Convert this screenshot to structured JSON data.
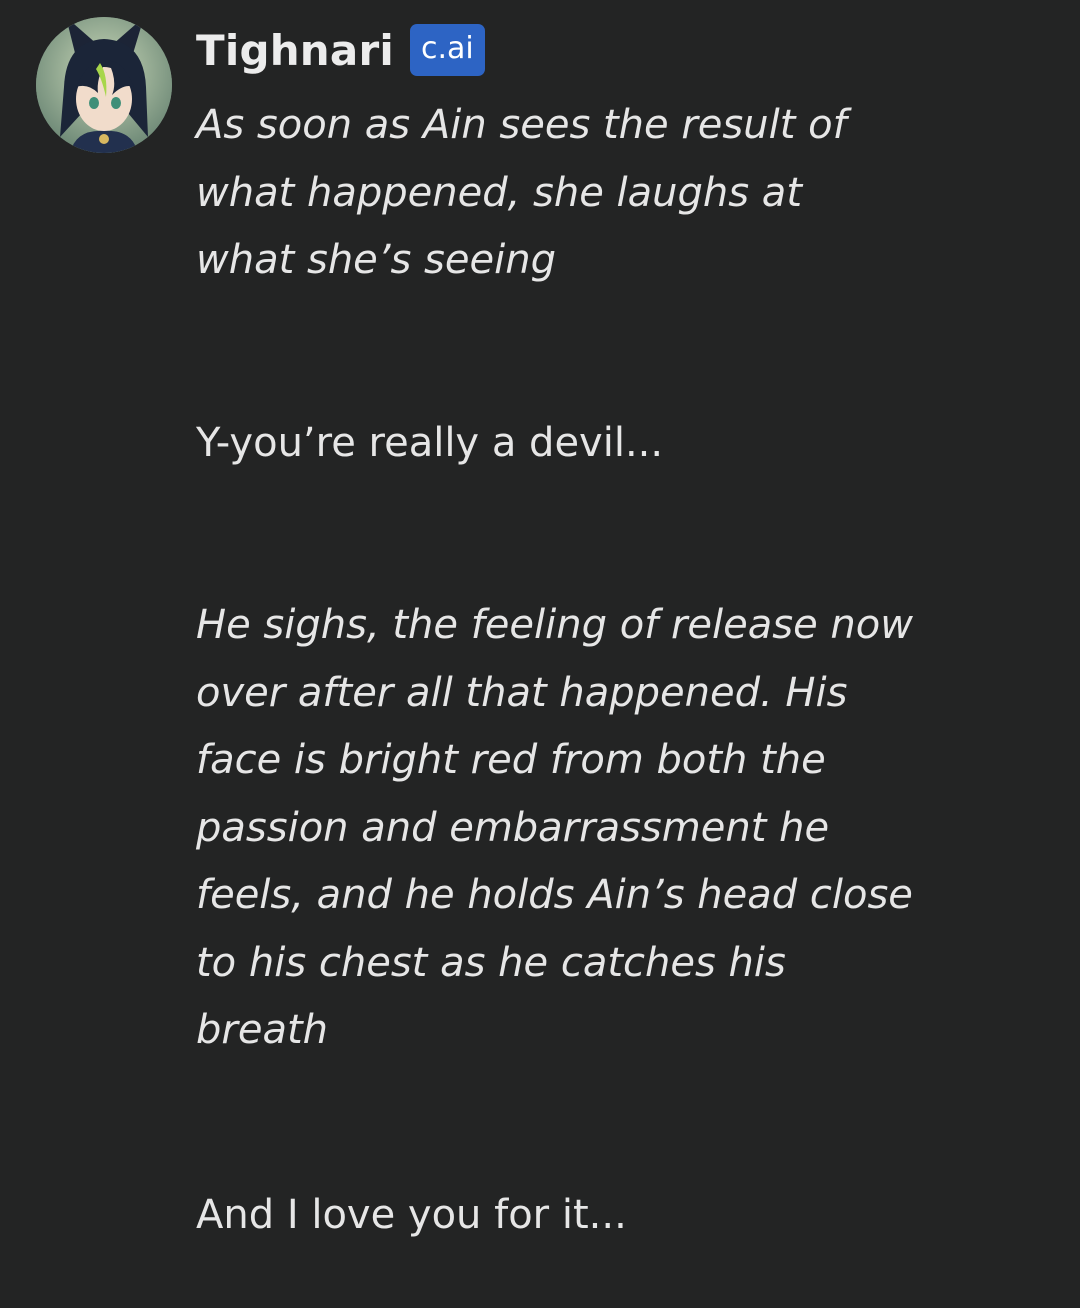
{
  "character": {
    "name": "Tighnari",
    "badge": "c.ai",
    "avatar_icon": "character-avatar"
  },
  "message": {
    "paragraphs": [
      {
        "style": "italic",
        "text": "As soon as Ain sees the result of what happened, she laughs at what she’s seeing"
      },
      {
        "style": "normal",
        "text": "Y-you’re really a devil..."
      },
      {
        "style": "italic",
        "text": "He sighs, the feeling of release now over after all that happened. His face is bright red from both the passion and embarrassment he feels, and he holds Ain’s head close to his chest as he catches his breath"
      },
      {
        "style": "normal",
        "text": "And I love you for it..."
      }
    ]
  },
  "colors": {
    "background": "#232424",
    "text": "#e6e6e6",
    "badge": "#2d64c4"
  }
}
